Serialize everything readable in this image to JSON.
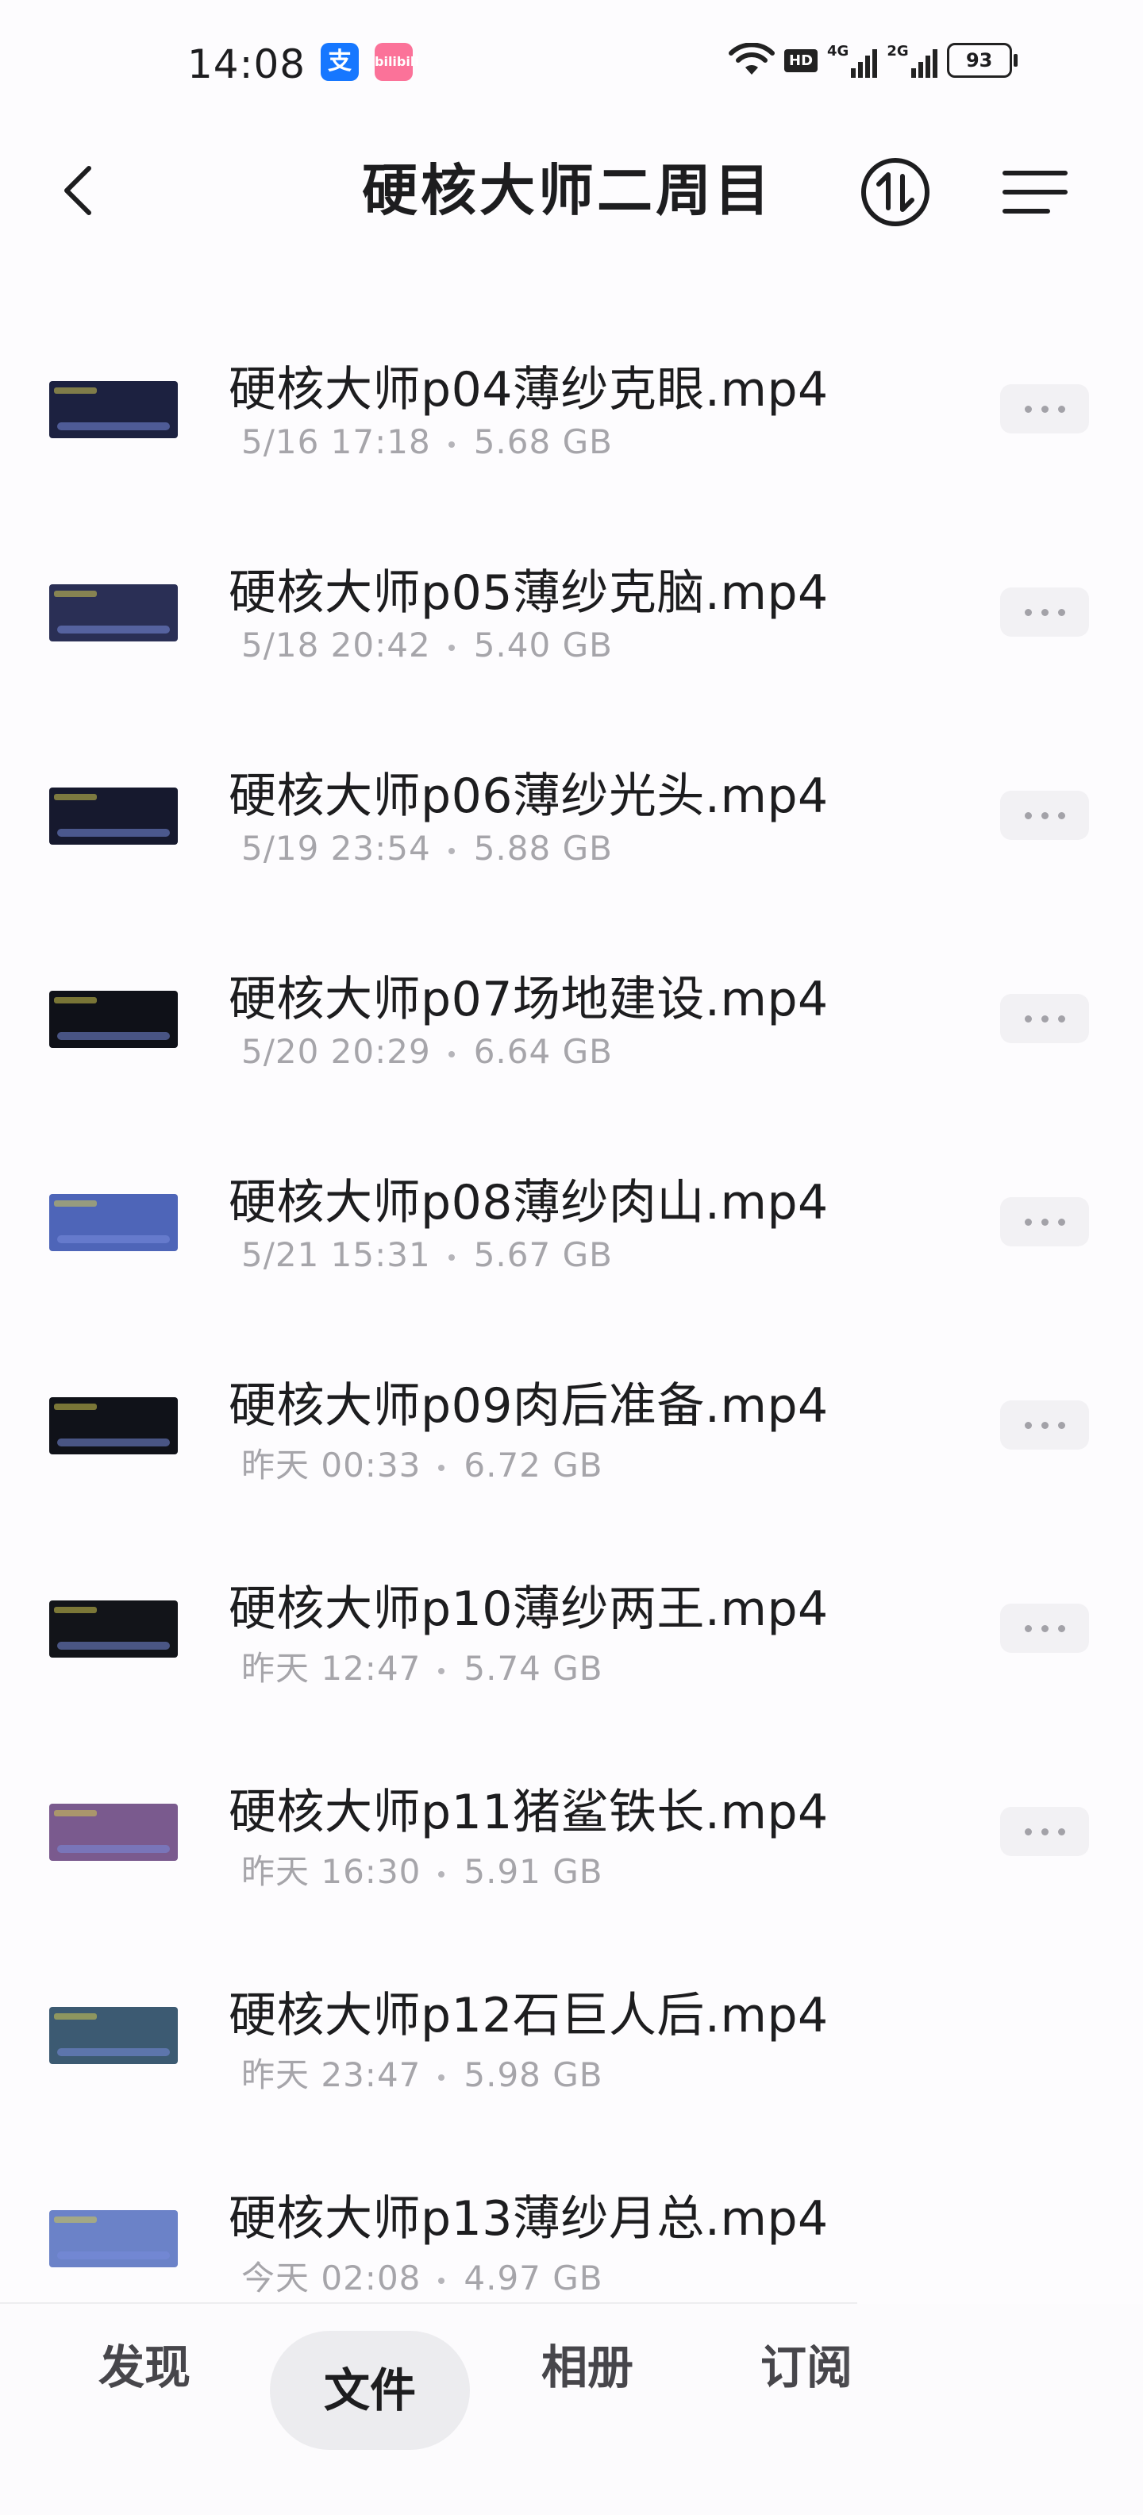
{
  "status_bar": {
    "time": "14:08",
    "app_badge_1": "支",
    "app_badge_2": "bilibili",
    "hd_label": "HD",
    "net_1": "4G",
    "net_2": "2G",
    "battery": "93"
  },
  "header": {
    "title": "硬核大师二周目"
  },
  "files": [
    {
      "name": "硬核大师p04薄纱克眼.mp4",
      "date": "5/16 17:18",
      "size": "5.68 GB",
      "thumb": "#1c2140"
    },
    {
      "name": "硬核大师p05薄纱克脑.mp4",
      "date": "5/18 20:42",
      "size": "5.40 GB",
      "thumb": "#2a2f55"
    },
    {
      "name": "硬核大师p06薄纱光头.mp4",
      "date": "5/19 23:54",
      "size": "5.88 GB",
      "thumb": "#16192e"
    },
    {
      "name": "硬核大师p07场地建设.mp4",
      "date": "5/20 20:29",
      "size": "6.64 GB",
      "thumb": "#0f1118"
    },
    {
      "name": "硬核大师p08薄纱肉山.mp4",
      "date": "5/21 15:31",
      "size": "5.67 GB",
      "thumb": "#4e65b8"
    },
    {
      "name": "硬核大师p09肉后准备.mp4",
      "date": "昨天 00:33",
      "size": "6.72 GB",
      "thumb": "#101219"
    },
    {
      "name": "硬核大师p10薄纱两王.mp4",
      "date": "昨天 12:47",
      "size": "5.74 GB",
      "thumb": "#121419"
    },
    {
      "name": "硬核大师p11猪鲨铁长.mp4",
      "date": "昨天 16:30",
      "size": "5.91 GB",
      "thumb": "#7a5a8e"
    },
    {
      "name": "硬核大师p12石巨人后.mp4",
      "date": "昨天 23:47",
      "size": "5.98 GB",
      "thumb": "#3c5a72"
    },
    {
      "name": "硬核大师p13薄纱月总.mp4",
      "date": "今天 02:08",
      "size": "4.97 GB",
      "thumb": "#6b82c8"
    }
  ],
  "bottom_nav": {
    "discover": "发现",
    "files": "文件",
    "albums": "相册",
    "subscribe": "订阅"
  }
}
